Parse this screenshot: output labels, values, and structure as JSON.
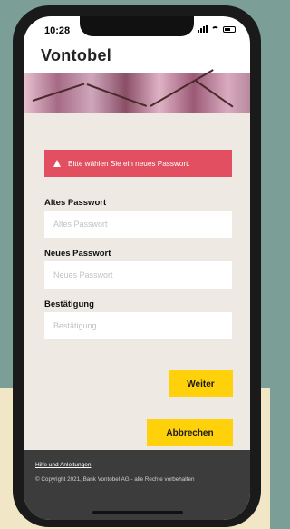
{
  "status_bar": {
    "time": "10:28"
  },
  "header": {
    "brand": "Vontobel"
  },
  "alert": {
    "icon": "warning-icon",
    "message": "Bitte wählen Sie ein neues Passwort.",
    "color": "#e14f61"
  },
  "form": {
    "old_password": {
      "label": "Altes Passwort",
      "placeholder": "Altes Passwort",
      "value": ""
    },
    "new_password": {
      "label": "Neues Passwort",
      "placeholder": "Neues Passwort",
      "value": ""
    },
    "confirm": {
      "label": "Bestätigung",
      "placeholder": "Bestätigung",
      "value": ""
    }
  },
  "actions": {
    "next_label": "Weiter",
    "cancel_label": "Abbrechen",
    "accent": "#ffd10a"
  },
  "footer": {
    "help_link": "Hilfe und Anleitungen",
    "copyright": "© Copyright 2021, Bank Vontobel AG - alle Rechte vorbehalten"
  }
}
